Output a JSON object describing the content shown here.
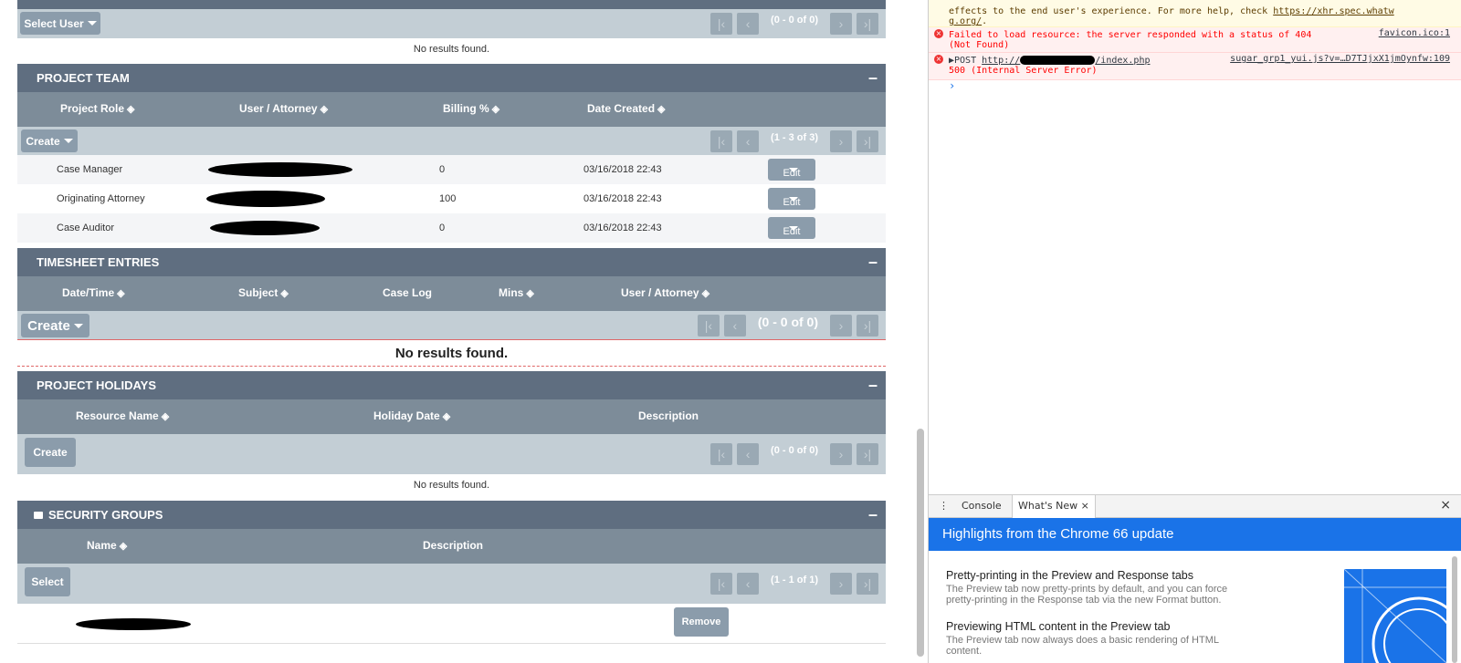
{
  "top_panel": {
    "select_label": "Select User",
    "pager": "(0 - 0 of 0)",
    "no_results": "No results found."
  },
  "project_team": {
    "title": "PROJECT TEAM",
    "columns": [
      "Project Role",
      "User / Attorney",
      "Billing %",
      "Date Created"
    ],
    "create_label": "Create",
    "pager": "(1 - 3 of 3)",
    "rows": [
      {
        "role": "Case Manager",
        "billing": "0",
        "date": "03/16/2018 22:43",
        "edit": "Edit"
      },
      {
        "role": "Originating Attorney",
        "billing": "100",
        "date": "03/16/2018 22:43",
        "edit": "Edit"
      },
      {
        "role": "Case Auditor",
        "billing": "0",
        "date": "03/16/2018 22:43",
        "edit": "Edit"
      }
    ]
  },
  "timesheet": {
    "title": "TIMESHEET ENTRIES",
    "columns": [
      "Date/Time",
      "Subject",
      "Case Log",
      "Mins",
      "User / Attorney"
    ],
    "create_label": "Create",
    "pager": "(0 - 0 of 0)",
    "no_results": "No results found."
  },
  "holidays": {
    "title": "PROJECT HOLIDAYS",
    "columns": [
      "Resource Name",
      "Holiday Date",
      "Description"
    ],
    "create_label": "Create",
    "pager": "(0 - 0 of 0)",
    "no_results": "No results found."
  },
  "security": {
    "title": "SECURITY GROUPS",
    "columns": [
      "Name",
      "Description"
    ],
    "select_label": "Select",
    "pager": "(1 - 1 of 1)",
    "remove_label": "Remove"
  },
  "panel_minimize": "–",
  "sort_glyph": "◈",
  "devtools": {
    "warn_line1": "effects to the end user's experience. For more help, check ",
    "warn_link1": "https://xhr.spec.whatw",
    "warn_link2": "g.org/",
    "warn_tail": ".",
    "err1_line1": "Failed to load resource: the server responded with a status of 404",
    "err1_line2": "(Not Found)",
    "err1_source": "favicon.ico:1",
    "err2_prefix": "▶POST ",
    "err2_url_start": "http://",
    "err2_url_end": "/index.php",
    "err2_source": "sugar_grp1_yui.js?v=…D7TJjxX1jmOynfw:109",
    "err2_line2": "500 (Internal Server Error)",
    "prompt": "›",
    "drawer_menu": "⋮",
    "tab_console": "Console",
    "tab_whatsnew": "What's New",
    "tab_close": "×",
    "drawer_close": "×",
    "banner": "Highlights from the Chrome 66 update",
    "features": [
      {
        "title": "Pretty-printing in the Preview and Response tabs",
        "desc1": "The Preview tab now pretty-prints by default, and you can force",
        "desc2": "pretty-printing in the Response tab via the new Format button."
      },
      {
        "title": "Previewing HTML content in the Preview tab",
        "desc1": "The Preview tab now always does a basic rendering of HTML",
        "desc2": "content."
      }
    ]
  }
}
